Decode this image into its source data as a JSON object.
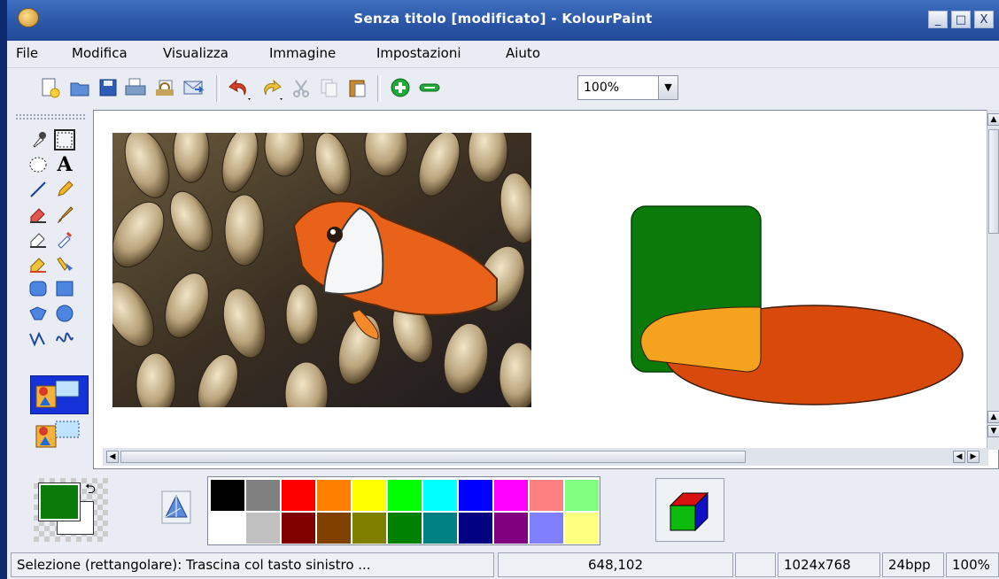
{
  "window": {
    "title": "Senza titolo [modificato] - KolourPaint",
    "controls": {
      "minimize": "_",
      "maximize": "□",
      "close": "X"
    }
  },
  "menu": {
    "items": [
      "File",
      "Modifica",
      "Visualizza",
      "Immagine",
      "Impostazioni",
      "Aiuto"
    ]
  },
  "toolbar": {
    "zoom_value": "100%",
    "buttons": [
      "new-icon",
      "open-icon",
      "save-icon",
      "print-icon",
      "print-preview-icon",
      "mail-icon",
      "undo-icon",
      "redo-icon",
      "cut-icon",
      "copy-icon",
      "paste-icon",
      "zoom-in-icon",
      "zoom-out-icon"
    ]
  },
  "tools": [
    "color-picker-icon",
    "rect-select-icon",
    "ellipse-select-icon",
    "text-icon",
    "line-icon",
    "pencil-icon",
    "eraser-icon",
    "brush-icon",
    "color-eraser-icon",
    "spraycan-icon",
    "flood-fill-icon",
    "color-washer-icon",
    "rounded-rect-icon",
    "rectangle-icon",
    "polygon-icon",
    "ellipse-icon",
    "polyline-icon",
    "curve-icon"
  ],
  "canvas": {
    "photo_alt": "clownfish-in-anemone",
    "shapes_colors": {
      "green": "#0a7a0a",
      "orange": "#d84a0c",
      "overlap": "#f5a21f"
    }
  },
  "colors": {
    "foreground": "#0a7a0a",
    "background": "#ffffff",
    "palette_row1": [
      "#000000",
      "#808080",
      "#ff0000",
      "#ff8000",
      "#ffff00",
      "#00ff00",
      "#00ffff",
      "#0000ff",
      "#ff00ff",
      "#ff8080",
      "#80ff80"
    ],
    "palette_row2": [
      "#ffffff",
      "#c0c0c0",
      "#800000",
      "#804000",
      "#808000",
      "#008000",
      "#008080",
      "#000080",
      "#800080",
      "#8080ff",
      "#ffff80"
    ]
  },
  "status": {
    "message": "Selezione (rettangolare): Trascina col tasto sinistro ...",
    "coords": "648,102",
    "selection": "",
    "dimensions": "1024x768",
    "depth": "24bpp",
    "zoom": "100%"
  }
}
